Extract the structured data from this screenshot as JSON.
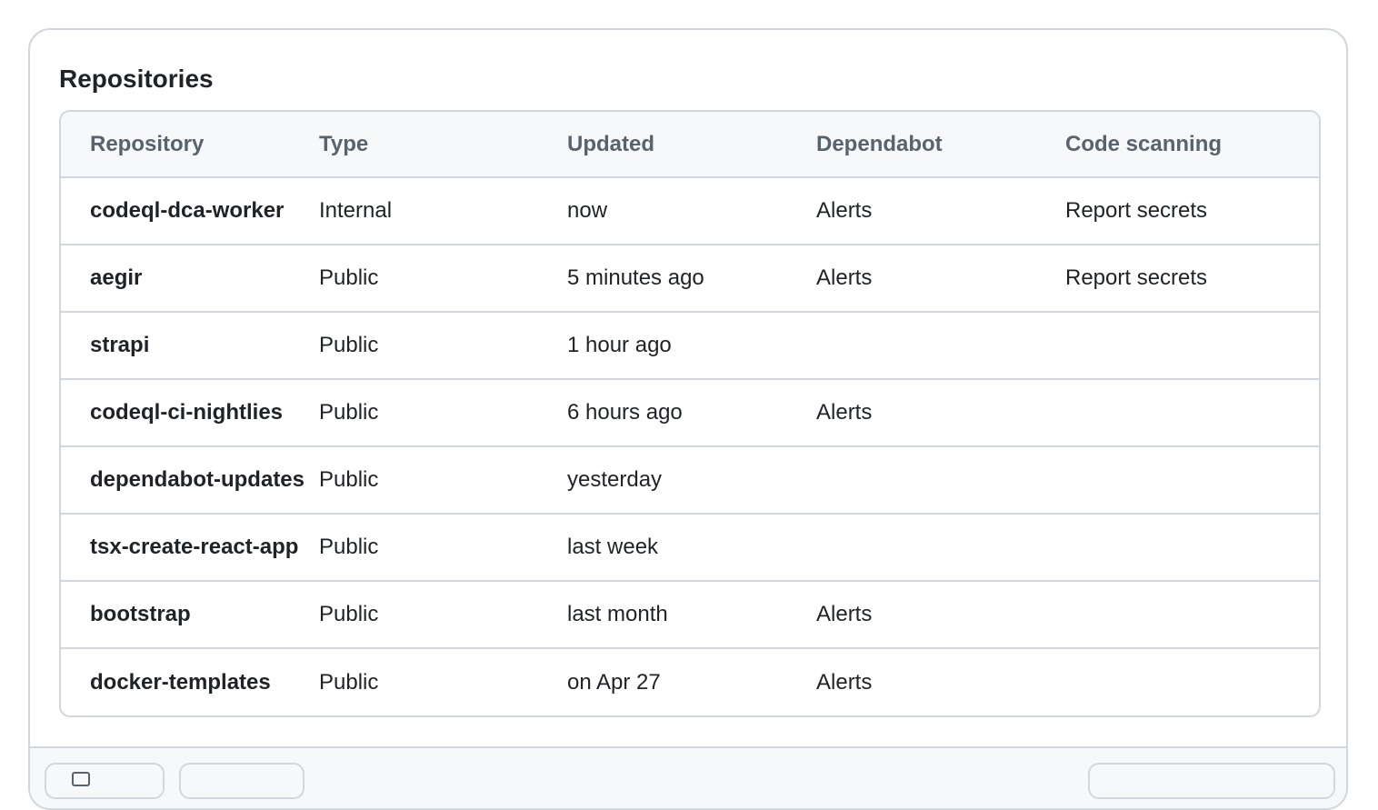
{
  "panel": {
    "title": "Repositories"
  },
  "table": {
    "columns": [
      "Repository",
      "Type",
      "Updated",
      "Dependabot",
      "Code scanning"
    ],
    "rows": [
      {
        "name": "codeql-dca-worker",
        "type": "Internal",
        "updated": "now",
        "dependabot": "Alerts",
        "code_scanning": "Report secrets"
      },
      {
        "name": "aegir",
        "type": "Public",
        "updated": "5 minutes ago",
        "dependabot": "Alerts",
        "code_scanning": "Report secrets"
      },
      {
        "name": "strapi",
        "type": "Public",
        "updated": "1 hour ago",
        "dependabot": "",
        "code_scanning": ""
      },
      {
        "name": "codeql-ci-nightlies",
        "type": "Public",
        "updated": "6 hours ago",
        "dependabot": "Alerts",
        "code_scanning": ""
      },
      {
        "name": "dependabot-updates",
        "type": "Public",
        "updated": "yesterday",
        "dependabot": "",
        "code_scanning": ""
      },
      {
        "name": "tsx-create-react-app",
        "type": "Public",
        "updated": "last week",
        "dependabot": "",
        "code_scanning": ""
      },
      {
        "name": "bootstrap",
        "type": "Public",
        "updated": "last month",
        "dependabot": "Alerts",
        "code_scanning": ""
      },
      {
        "name": "docker-templates",
        "type": "Public",
        "updated": "on Apr 27",
        "dependabot": "Alerts",
        "code_scanning": ""
      }
    ]
  },
  "footer": {
    "icons": [
      "window-icon"
    ]
  },
  "colors": {
    "border": "#d0d7de",
    "header_bg": "#f6f8fa",
    "header_text": "#59636e",
    "text": "#1f2328"
  }
}
